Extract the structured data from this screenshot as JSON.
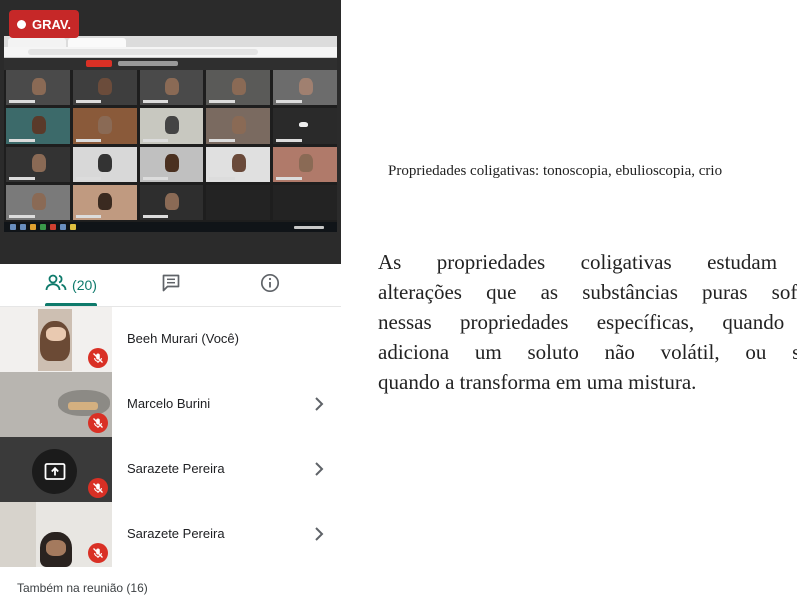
{
  "recording": {
    "label": "GRAV.",
    "color": "#c62828"
  },
  "tabs": {
    "people_icon": "people-icon",
    "people_count": "(20)",
    "chat_icon": "chat-icon",
    "info_icon": "info-icon",
    "accent": "#0e7a6b"
  },
  "participants": [
    {
      "name": "Beeh Murari (Você)",
      "mic": "muted",
      "has_chevron": false
    },
    {
      "name": "Marcelo Burini",
      "mic": "muted",
      "has_chevron": true
    },
    {
      "name": "Sarazete Pereira",
      "mic": "muted",
      "has_chevron": true,
      "presenting_icon": "present-screen-icon"
    },
    {
      "name": "Sarazete Pereira",
      "mic": "muted",
      "has_chevron": true
    }
  ],
  "also_in_meeting": "Também na reunião (16)",
  "slide": {
    "title": "Propriedades coligativas: tonoscopia, ebulioscopia, crio",
    "body_lines": [
      "As propriedades coligativas estudam as",
      "alterações que as substâncias puras sofrem",
      "nessas propriedades específicas, quando se",
      "adiciona um soluto não volátil, ou seja,",
      "quando a transforma em uma mistura."
    ]
  }
}
